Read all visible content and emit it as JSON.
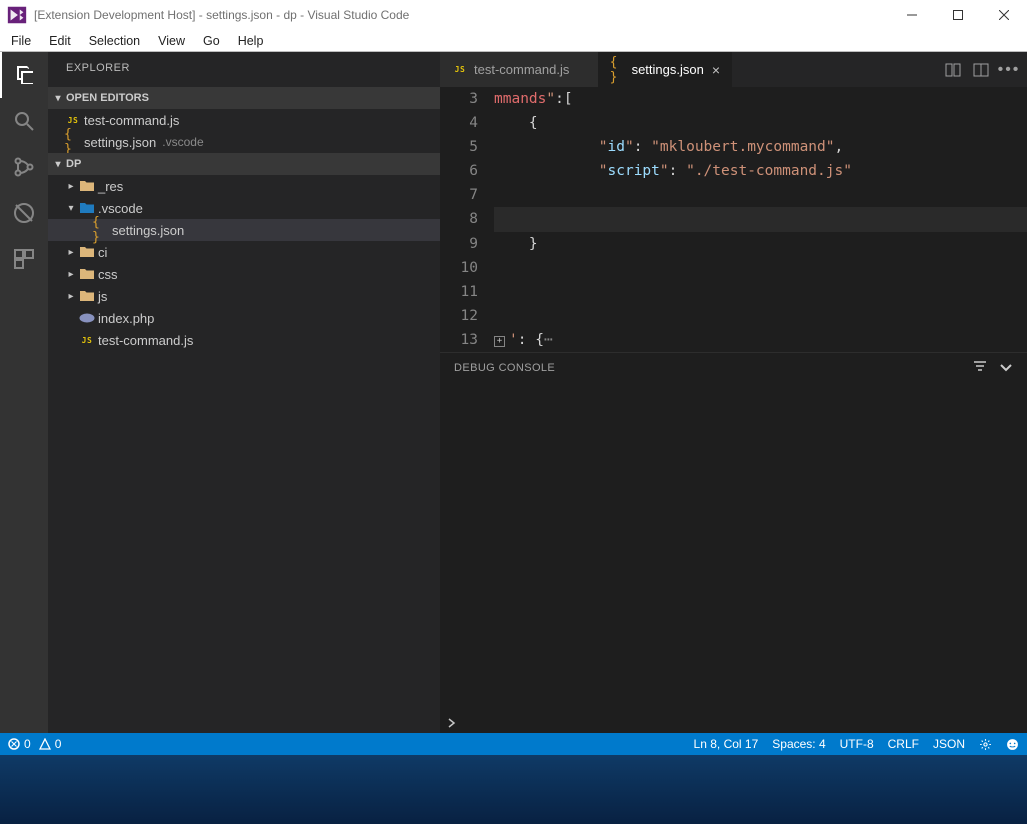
{
  "window": {
    "title": "[Extension Development Host] - settings.json - dp - Visual Studio Code"
  },
  "menu": {
    "items": [
      "File",
      "Edit",
      "Selection",
      "View",
      "Go",
      "Help"
    ]
  },
  "sidebar": {
    "title": "EXPLORER",
    "sections": {
      "openEditors": {
        "label": "OPEN EDITORS",
        "items": [
          {
            "name": "test-command.js",
            "icon": "js"
          },
          {
            "name": "settings.json",
            "icon": "braces",
            "detail": ".vscode"
          }
        ]
      },
      "workspace": {
        "label": "DP",
        "tree": [
          {
            "name": "_res",
            "kind": "folder",
            "expanded": false,
            "depth": 1
          },
          {
            "name": ".vscode",
            "kind": "folder-vscode",
            "expanded": true,
            "depth": 1
          },
          {
            "name": "settings.json",
            "kind": "file",
            "icon": "braces",
            "depth": 2,
            "selected": true
          },
          {
            "name": "ci",
            "kind": "folder",
            "expanded": false,
            "depth": 1
          },
          {
            "name": "css",
            "kind": "folder-css",
            "expanded": false,
            "depth": 1
          },
          {
            "name": "js",
            "kind": "folder-js",
            "expanded": false,
            "depth": 1
          },
          {
            "name": "index.php",
            "kind": "file",
            "icon": "php",
            "depth": 1
          },
          {
            "name": "test-command.js",
            "kind": "file",
            "icon": "js",
            "depth": 1
          }
        ]
      }
    }
  },
  "tabs": [
    {
      "label": "test-command.js",
      "active": false,
      "icon": "js"
    },
    {
      "label": "settings.json",
      "active": true,
      "icon": "braces"
    }
  ],
  "editor": {
    "startLine": 3,
    "lines": [
      {
        "n": 3,
        "html": "<span class='tok-err'>mmands</span><span class='tok-str'>\"</span><span class='tok-brace'>:[</span>"
      },
      {
        "n": 4,
        "html": "<span class='tok-brace'>{</span>",
        "pad": 1
      },
      {
        "n": 5,
        "html": "<span class='tok-str'>\"</span><span class='tok-key'>id</span><span class='tok-str'>\"</span><span class='tok-brace'>: </span><span class='tok-str'>\"mkloubert.mycommand\"</span><span class='tok-brace'>,</span>",
        "pad": 3
      },
      {
        "n": 6,
        "html": "<span class='tok-str'>\"</span><span class='tok-key'>script</span><span class='tok-str'>\"</span><span class='tok-brace'>: </span><span class='tok-str'>\"./test-command.js\"</span>",
        "pad": 3
      },
      {
        "n": 7,
        "html": ""
      },
      {
        "n": 8,
        "html": "",
        "cursor": true
      },
      {
        "n": 9,
        "html": "<span class='tok-brace'>}</span>",
        "pad": 1
      },
      {
        "n": 10,
        "html": ""
      },
      {
        "n": 11,
        "html": ""
      },
      {
        "n": 12,
        "html": ""
      },
      {
        "n": 13,
        "html": "<span class='fold-sq'>+</span><span class='tok-str'>'</span><span class='tok-brace'>: {</span><span style='color:#858585'>&#x22EF;</span>",
        "fold": true
      }
    ]
  },
  "panel": {
    "title": "DEBUG CONSOLE"
  },
  "status": {
    "errors": "0",
    "warnings": "0",
    "lncol": "Ln 8, Col 17",
    "spaces": "Spaces: 4",
    "encoding": "UTF-8",
    "eol": "CRLF",
    "lang": "JSON"
  }
}
